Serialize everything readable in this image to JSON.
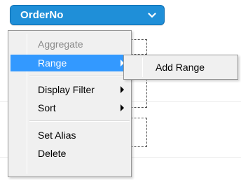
{
  "field": {
    "label": "OrderNo",
    "dropdown_icon": "chevron-down-icon"
  },
  "context_menu": {
    "items": [
      {
        "label": "Aggregate",
        "enabled": false,
        "submenu": false
      },
      {
        "label": "Range",
        "enabled": true,
        "submenu": true,
        "highlighted": true
      },
      {
        "label": "Display Filter",
        "enabled": true,
        "submenu": true
      },
      {
        "label": "Sort",
        "enabled": true,
        "submenu": true
      },
      {
        "label": "Set Alias",
        "enabled": true,
        "submenu": false
      },
      {
        "label": "Delete",
        "enabled": true,
        "submenu": false
      }
    ]
  },
  "range_submenu": {
    "items": [
      {
        "label": "Add Range"
      }
    ]
  },
  "colors": {
    "pill_background": "#1f8fd8",
    "highlight": "#3399ff",
    "menu_background": "#f0f0f0"
  }
}
